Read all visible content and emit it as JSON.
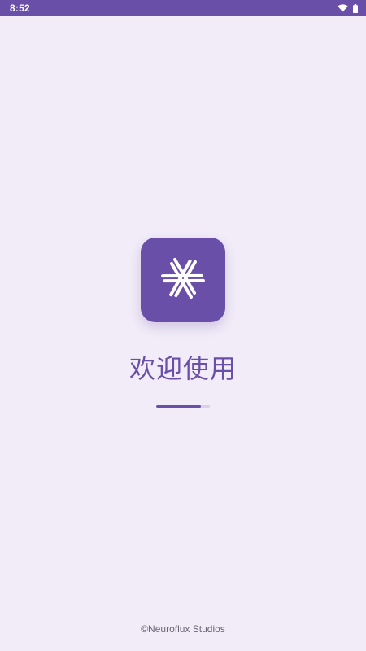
{
  "status_bar": {
    "time": "8:52",
    "icons": [
      "wifi-icon",
      "battery-icon"
    ]
  },
  "splash": {
    "logo_icon": "snowflake-logo-icon",
    "title": "欢迎使用",
    "progress": 0.83,
    "copyright": "©Neuroflux Studios"
  },
  "colors": {
    "brand": "#6a4fa9",
    "background": "#f1ecf8",
    "progress_track": "#d9cfee",
    "footer_text": "#6a6575"
  }
}
